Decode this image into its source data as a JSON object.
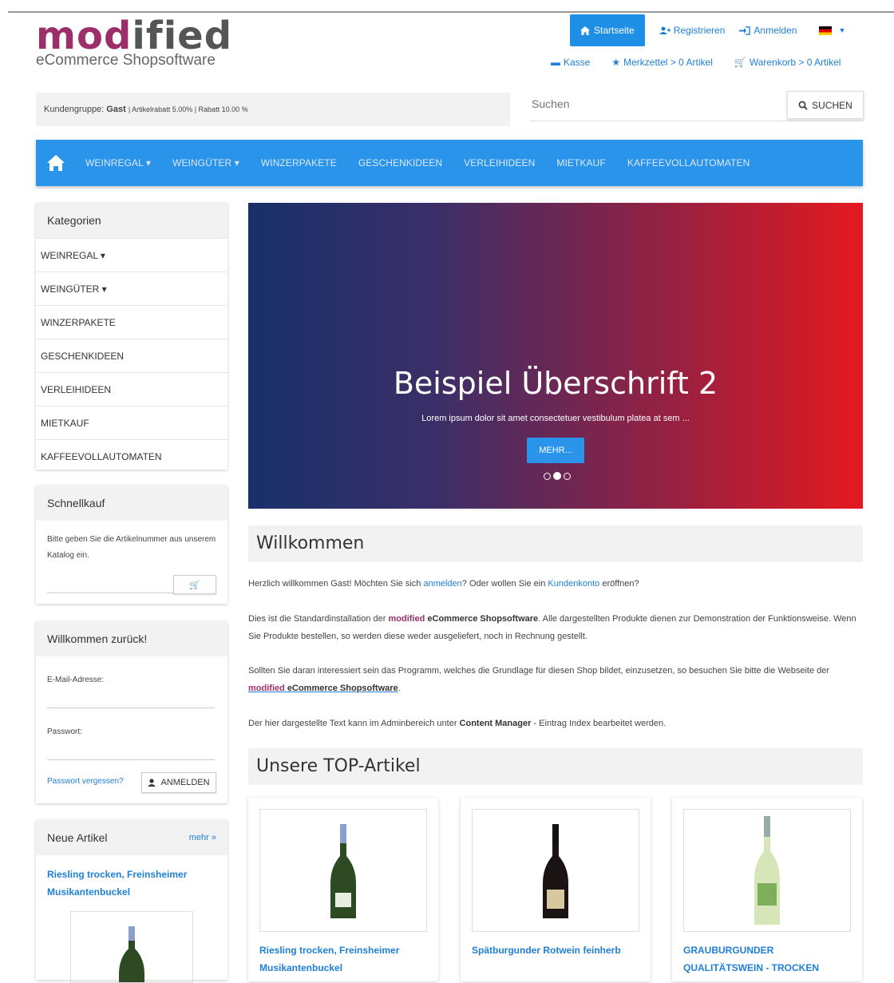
{
  "logo": {
    "main_1": "mod",
    "main_2": "ified",
    "sub": "eCommerce Shopsoftware"
  },
  "topnav": {
    "home": "Startseite",
    "register": "Registrieren",
    "login": "Anmelden"
  },
  "subnav": {
    "checkout": "Kasse",
    "wishlist": "Merkzettel",
    "wishlist_count": "> 0 Artikel",
    "cart": "Warenkorb",
    "cart_count": "> 0 Artikel"
  },
  "customer_group": {
    "label": "Kundengruppe:",
    "value": "Gast",
    "details": "| Artikelrabatt 5.00% | Rabatt 10.00 %"
  },
  "search": {
    "placeholder": "Suchen",
    "button": "SUCHEN"
  },
  "mainnav": {
    "items": [
      "WEINREGAL",
      "WEINGÜTER",
      "WINZERPAKETE",
      "GESCHENKIDEEN",
      "VERLEIHIDEEN",
      "MIETKAUF",
      "KAFFEEVOLLAUTOMATEN"
    ]
  },
  "categories": {
    "title": "Kategorien",
    "items": [
      "WEINREGAL",
      "WEINGÜTER",
      "WINZERPAKETE",
      "GESCHENKIDEEN",
      "VERLEIHIDEEN",
      "MIETKAUF",
      "KAFFEEVOLLAUTOMATEN"
    ]
  },
  "quickbuy": {
    "title": "Schnellkauf",
    "text": "Bitte geben Sie die Artikelnummer aus unserem Katalog ein."
  },
  "login_box": {
    "title": "Willkommen zurück!",
    "email_label": "E-Mail-Adresse:",
    "password_label": "Passwort:",
    "forgot": "Passwort vergessen?",
    "button": "ANMELDEN"
  },
  "new_articles": {
    "title": "Neue Artikel",
    "more": "mehr »",
    "item_title": "Riesling trocken, Freinsheimer Musikantenbuckel"
  },
  "slider": {
    "heading": "Beispiel Überschrift 2",
    "text": "Lorem ipsum dolor sit amet consectetuer vestibulum platea at sem ...",
    "button": "MEHR...",
    "active_slide": 2,
    "slide_count": 3
  },
  "welcome": {
    "title": "Willkommen",
    "p1_a": "Herzlich willkommen Gast! Möchten Sie sich ",
    "p1_link1": "anmelden",
    "p1_b": "? Oder wollen Sie ein ",
    "p1_link2": "Kundenkonto",
    "p1_c": " eröffnen?",
    "p2_a": "Dies ist die Standardinstallation der ",
    "p2_brand": "modified",
    "p2_brand2": " eCommerce Shopsoftware",
    "p2_b": ". Alle dargestellten Produkte dienen zur Demonstration der Funktionsweise. Wenn Sie Produkte bestellen, so werden diese weder ausgeliefert, noch in Rechnung gestellt.",
    "p3_a": "Sollten Sie daran interessiert sein das Programm, welches die Grundlage für diesen Shop bildet, einzusetzen, so besuchen Sie bitte die Webseite der ",
    "p3_brand": "modified",
    "p3_brand2": " eCommerce Shopsoftware",
    "p3_b": ".",
    "p4_a": "Der hier dargestellte Text kann im Adminbereich unter ",
    "p4_b": "Content Manager",
    "p4_c": " - Eintrag Index bearbeitet werden."
  },
  "top_articles": {
    "title": "Unsere TOP-Artikel",
    "items": [
      "Riesling trocken, Freinsheimer Musikantenbuckel",
      "Spätburgunder Rotwein feinherb",
      "GRAUBURGUNDER QUALITÄTSWEIN - TROCKEN"
    ]
  },
  "colors": {
    "brand_purple": "#9c2f6a",
    "accent_blue": "#2a93ea",
    "link_blue": "#1f7fd6"
  }
}
